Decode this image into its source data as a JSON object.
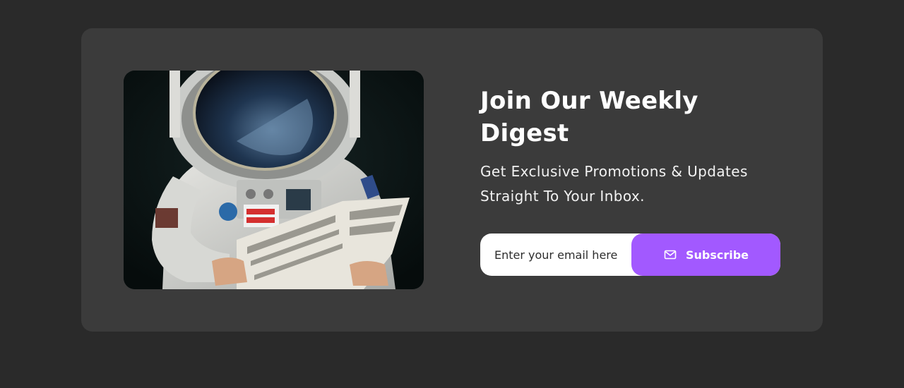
{
  "newsletter": {
    "title_line1": "Join Our Weekly",
    "title_line2": "Digest",
    "subtitle_line1": "Get Exclusive Promotions & Updates",
    "subtitle_line2": "Straight To Your Inbox.",
    "email_placeholder": "Enter your email here",
    "subscribe_label": "Subscribe",
    "subscribe_icon": "mail-icon",
    "image_subject": "astronaut-reading-newspaper"
  },
  "colors": {
    "page_background": "#2a2a2a",
    "card_background": "#3b3b3b",
    "accent": "#a259ff",
    "text": "#ffffff"
  }
}
